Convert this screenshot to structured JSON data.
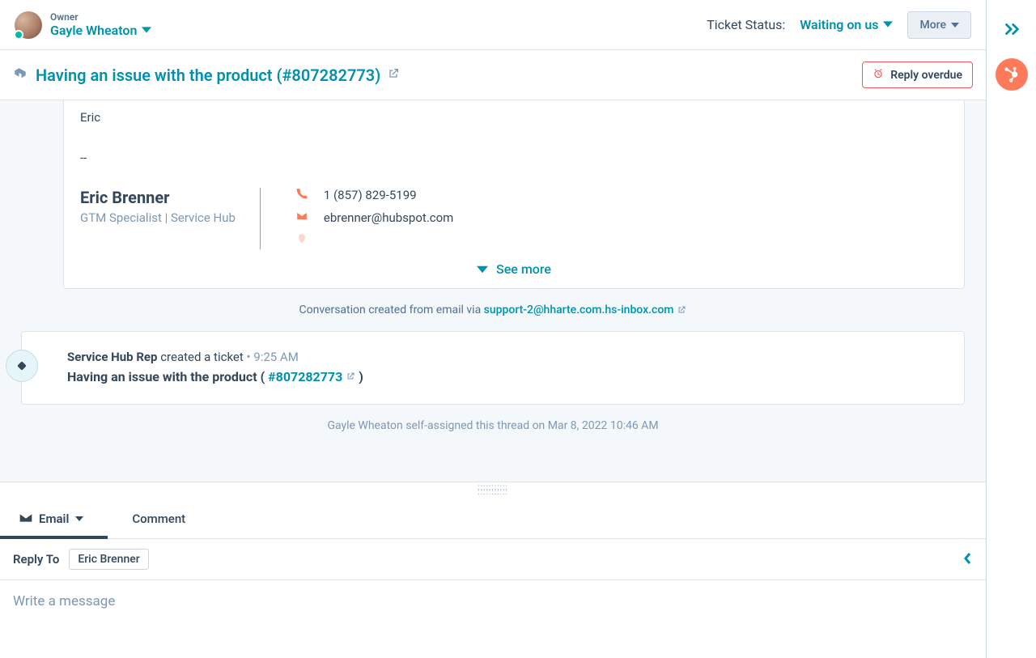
{
  "header": {
    "owner_label": "Owner",
    "owner_name": "Gayle Wheaton",
    "status_label": "Ticket Status:",
    "status_value": "Waiting on us",
    "more_label": "More"
  },
  "ticket": {
    "title": "Having an issue with the product (#807282773)",
    "overdue_label": "Reply overdue"
  },
  "message": {
    "closing_name": "Eric",
    "separator": "--",
    "sig_name": "Eric Brenner",
    "sig_title": "GTM Specialist | Service Hub",
    "sig_phone": "1 (857) 829-5199",
    "sig_email": "ebrenner@hubspot.com",
    "see_more": "See more"
  },
  "source": {
    "prefix": "Conversation created from email via ",
    "link": "support-2@hharte.com.hs-inbox.com"
  },
  "event": {
    "actor": "Service Hub Rep",
    "action": " created a ticket",
    "dot": " • ",
    "time": "9:25 AM",
    "title": "Having an issue with the product",
    "open_paren": " ( ",
    "number": "#807282773",
    "close_paren": " )"
  },
  "self_assign": "Gayle Wheaton self-assigned this thread on Mar 8, 2022 10:46 AM",
  "compose": {
    "tab_email": "Email",
    "tab_comment": "Comment",
    "reply_to_label": "Reply To",
    "reply_to_chip": "Eric Brenner",
    "placeholder": "Write a message"
  }
}
